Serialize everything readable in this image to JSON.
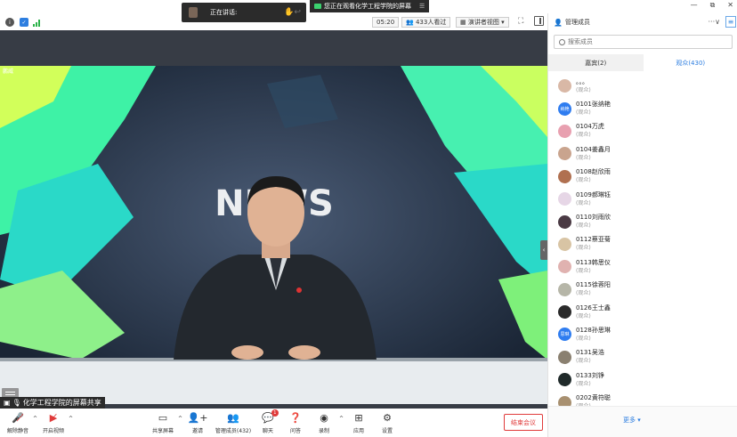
{
  "topbar": {
    "speaking_label": "正在讲话:",
    "viewing_text": "您正在观看化学工程学院的屏幕",
    "window_controls": [
      "—",
      "⧉",
      "✕"
    ]
  },
  "toolbar": {
    "timer": "05:20",
    "viewers": "433人看过",
    "layout": "演讲者视图"
  },
  "stage": {
    "screen_share_label": "化学工程学院的屏幕共享",
    "video_title": "NEWS",
    "overlay_tag": "鹏威"
  },
  "bottombar": {
    "buttons": [
      {
        "label": "解除静音",
        "icon": "mic-muted-icon"
      },
      {
        "label": "开启视频",
        "icon": "camera-off-icon"
      },
      {
        "label": "共享屏幕",
        "icon": "share-screen-icon"
      },
      {
        "label": "邀请",
        "icon": "invite-icon"
      },
      {
        "label": "管理成员(432)",
        "icon": "members-icon"
      },
      {
        "label": "聊天",
        "icon": "chat-icon",
        "badge": "1"
      },
      {
        "label": "问答",
        "icon": "qa-icon"
      },
      {
        "label": "录制",
        "icon": "record-icon"
      },
      {
        "label": "应用",
        "icon": "apps-icon"
      },
      {
        "label": "设置",
        "icon": "settings-icon"
      }
    ],
    "end_meeting": "结束会议"
  },
  "panel": {
    "title": "管理成员",
    "search_placeholder": "搜索成员",
    "tabs": {
      "guests": "嘉宾(2)",
      "audience": "观众(430)"
    },
    "role": "(观众)",
    "members": [
      {
        "name": "。。。",
        "avatar": "photo",
        "color": "#d9b8a6"
      },
      {
        "name": "0101张纳艳",
        "avatar": "text",
        "avatar_text": "纳艳"
      },
      {
        "name": "0104万虎",
        "avatar": "photo",
        "color": "#e8a0b0"
      },
      {
        "name": "0104姜鑫月",
        "avatar": "photo",
        "color": "#c9a48e"
      },
      {
        "name": "0108赵欣雨",
        "avatar": "photo",
        "color": "#b07050"
      },
      {
        "name": "0109郝琳钰",
        "avatar": "photo",
        "color": "#e6d6e6"
      },
      {
        "name": "0110刘雨欣",
        "avatar": "photo",
        "color": "#4a3a44"
      },
      {
        "name": "0112蔡亚菊",
        "avatar": "photo",
        "color": "#d8c4a4"
      },
      {
        "name": "0113韩思仪",
        "avatar": "photo",
        "color": "#e0b2b0"
      },
      {
        "name": "0115徐蓉阳",
        "avatar": "photo",
        "color": "#b6b6a8"
      },
      {
        "name": "0126王士鑫",
        "avatar": "photo",
        "color": "#2a2a2a"
      },
      {
        "name": "0128孙思琳",
        "avatar": "text",
        "avatar_text": "思琳"
      },
      {
        "name": "0131吴浩",
        "avatar": "photo",
        "color": "#8a8070"
      },
      {
        "name": "0133刘铮",
        "avatar": "photo",
        "color": "#202a2a"
      },
      {
        "name": "0202黄符聪",
        "avatar": "photo",
        "color": "#a89070"
      }
    ],
    "more_label": "更多 ▾"
  }
}
